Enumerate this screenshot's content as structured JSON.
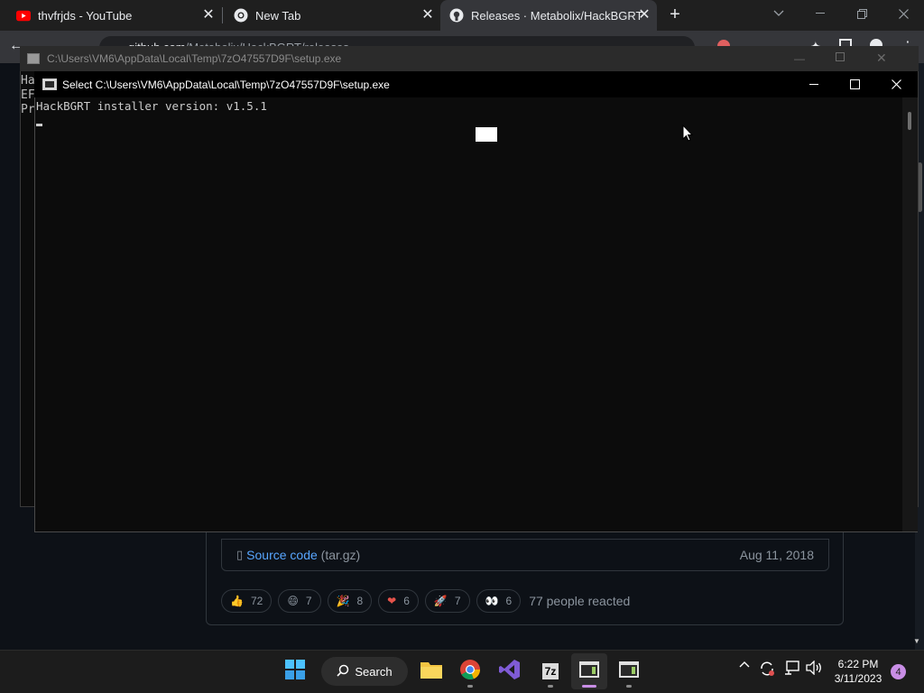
{
  "browser": {
    "tabs": [
      {
        "title": "thvfrjds - YouTube",
        "icon": "youtube-icon"
      },
      {
        "title": "New Tab",
        "icon": "chrome-icon"
      },
      {
        "title": "Releases · Metabolix/HackBGRT",
        "icon": "github-icon",
        "active": true
      }
    ],
    "new_tab_symbol": "+",
    "url_host": "github.com",
    "url_path": "/Metabolix/HackBGRT/releases"
  },
  "github": {
    "source_code_label": "Source code",
    "source_code_format": "(tar.gz)",
    "source_code_date": "Aug 11, 2018",
    "reactions": [
      {
        "emoji": "👍",
        "name": "thumbs-up",
        "count": "72"
      },
      {
        "emoji": "😄",
        "name": "laugh",
        "count": "7"
      },
      {
        "emoji": "🎉",
        "name": "hooray",
        "count": "8"
      },
      {
        "emoji": "❤",
        "name": "heart",
        "count": "6"
      },
      {
        "emoji": "🚀",
        "name": "rocket",
        "count": "7"
      },
      {
        "emoji": "👀",
        "name": "eyes",
        "count": "6"
      }
    ],
    "reaction_summary": "77 people reacted"
  },
  "back_console": {
    "title": "C:\\Users\\VM6\\AppData\\Local\\Temp\\7zO47557D9F\\setup.exe",
    "lines": "Ha\nEF\nPr"
  },
  "front_console": {
    "title": "Select C:\\Users\\VM6\\AppData\\Local\\Temp\\7zO47557D9F\\setup.exe",
    "output": "HackBGRT installer version: v1.5.1"
  },
  "taskbar": {
    "search_label": "Search",
    "time": "6:22 PM",
    "date": "3/11/2023",
    "notification_count": "4"
  }
}
